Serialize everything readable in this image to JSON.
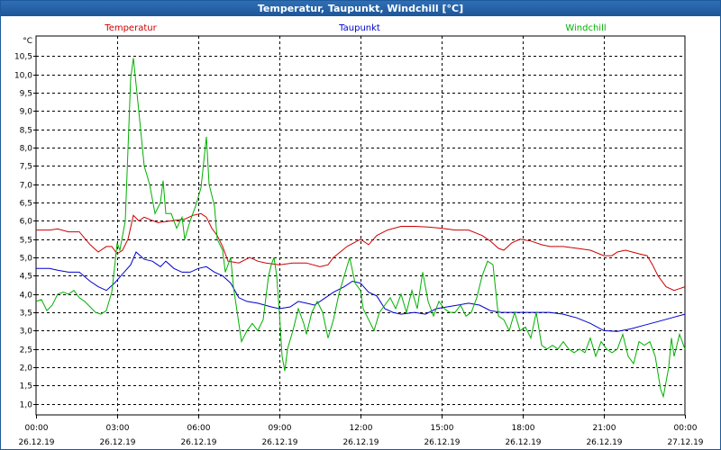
{
  "window": {
    "title": "Temperatur, Taupunkt, Windchill [°C]"
  },
  "chart_data": {
    "type": "line",
    "title": "Temperatur, Taupunkt, Windchill [°C]",
    "ylabel": "°C",
    "xlabel": "",
    "xlim": [
      0,
      24
    ],
    "ylim": [
      0.7,
      11.05
    ],
    "grid": true,
    "legend_placement": "top",
    "y_ticks": [
      "1,0",
      "1,5",
      "2,0",
      "2,5",
      "3,0",
      "3,5",
      "4,0",
      "4,5",
      "5,0",
      "5,5",
      "6,0",
      "6,5",
      "7,0",
      "7,5",
      "8,0",
      "8,5",
      "9,0",
      "9,5",
      "10,0",
      "10,5"
    ],
    "y_tick_values": [
      1.0,
      1.5,
      2.0,
      2.5,
      3.0,
      3.5,
      4.0,
      4.5,
      5.0,
      5.5,
      6.0,
      6.5,
      7.0,
      7.5,
      8.0,
      8.5,
      9.0,
      9.5,
      10.0,
      10.5
    ],
    "x_ticks": [
      {
        "x": 0,
        "time": "00:00",
        "date": "26.12.19"
      },
      {
        "x": 3,
        "time": "03:00",
        "date": "26.12.19"
      },
      {
        "x": 6,
        "time": "06:00",
        "date": "26.12.19"
      },
      {
        "x": 9,
        "time": "09:00",
        "date": "26.12.19"
      },
      {
        "x": 12,
        "time": "12:00",
        "date": "26.12.19"
      },
      {
        "x": 15,
        "time": "15:00",
        "date": "26.12.19"
      },
      {
        "x": 18,
        "time": "18:00",
        "date": "26.12.19"
      },
      {
        "x": 21,
        "time": "21:00",
        "date": "26.12.19"
      },
      {
        "x": 24,
        "time": "00:00",
        "date": "27.12.19"
      }
    ],
    "series": [
      {
        "name": "Temperatur",
        "color": "#cc0000",
        "points": [
          [
            0,
            5.75
          ],
          [
            0.5,
            5.75
          ],
          [
            0.8,
            5.78
          ],
          [
            1.2,
            5.7
          ],
          [
            1.6,
            5.7
          ],
          [
            2.0,
            5.35
          ],
          [
            2.3,
            5.15
          ],
          [
            2.6,
            5.3
          ],
          [
            2.8,
            5.3
          ],
          [
            2.9,
            5.2
          ],
          [
            3.0,
            5.1
          ],
          [
            3.2,
            5.2
          ],
          [
            3.4,
            5.5
          ],
          [
            3.6,
            6.15
          ],
          [
            3.8,
            6.0
          ],
          [
            4.0,
            6.1
          ],
          [
            4.5,
            5.95
          ],
          [
            5.0,
            6.0
          ],
          [
            5.5,
            6.05
          ],
          [
            5.8,
            6.15
          ],
          [
            6.1,
            6.2
          ],
          [
            6.3,
            6.1
          ],
          [
            6.5,
            5.8
          ],
          [
            6.7,
            5.6
          ],
          [
            6.9,
            5.3
          ],
          [
            7.1,
            4.9
          ],
          [
            7.5,
            4.85
          ],
          [
            7.9,
            5.0
          ],
          [
            8.2,
            4.9
          ],
          [
            8.5,
            4.85
          ],
          [
            9.0,
            4.8
          ],
          [
            9.5,
            4.85
          ],
          [
            10.0,
            4.85
          ],
          [
            10.5,
            4.75
          ],
          [
            10.8,
            4.8
          ],
          [
            11.0,
            5.0
          ],
          [
            11.5,
            5.3
          ],
          [
            12.0,
            5.5
          ],
          [
            12.3,
            5.35
          ],
          [
            12.6,
            5.6
          ],
          [
            13.0,
            5.75
          ],
          [
            13.5,
            5.85
          ],
          [
            14.0,
            5.85
          ],
          [
            14.5,
            5.83
          ],
          [
            15.0,
            5.8
          ],
          [
            15.5,
            5.75
          ],
          [
            16.0,
            5.75
          ],
          [
            16.5,
            5.6
          ],
          [
            16.8,
            5.45
          ],
          [
            17.1,
            5.25
          ],
          [
            17.3,
            5.2
          ],
          [
            17.6,
            5.4
          ],
          [
            17.9,
            5.5
          ],
          [
            18.3,
            5.45
          ],
          [
            18.7,
            5.35
          ],
          [
            19.0,
            5.3
          ],
          [
            19.5,
            5.3
          ],
          [
            20.0,
            5.25
          ],
          [
            20.5,
            5.2
          ],
          [
            21.0,
            5.05
          ],
          [
            21.3,
            5.05
          ],
          [
            21.5,
            5.15
          ],
          [
            21.8,
            5.2
          ],
          [
            22.3,
            5.1
          ],
          [
            22.6,
            5.05
          ],
          [
            22.8,
            4.8
          ],
          [
            23.0,
            4.5
          ],
          [
            23.3,
            4.2
          ],
          [
            23.6,
            4.1
          ],
          [
            23.8,
            4.15
          ],
          [
            24.0,
            4.2
          ]
        ]
      },
      {
        "name": "Taupunkt",
        "color": "#0000cc",
        "points": [
          [
            0,
            4.7
          ],
          [
            0.5,
            4.7
          ],
          [
            0.8,
            4.65
          ],
          [
            1.2,
            4.6
          ],
          [
            1.6,
            4.6
          ],
          [
            2.0,
            4.35
          ],
          [
            2.3,
            4.2
          ],
          [
            2.6,
            4.1
          ],
          [
            2.9,
            4.3
          ],
          [
            3.2,
            4.55
          ],
          [
            3.5,
            4.8
          ],
          [
            3.7,
            5.15
          ],
          [
            4.0,
            4.95
          ],
          [
            4.3,
            4.9
          ],
          [
            4.6,
            4.75
          ],
          [
            4.8,
            4.9
          ],
          [
            5.1,
            4.7
          ],
          [
            5.4,
            4.6
          ],
          [
            5.7,
            4.6
          ],
          [
            6.0,
            4.7
          ],
          [
            6.3,
            4.75
          ],
          [
            6.6,
            4.6
          ],
          [
            6.9,
            4.5
          ],
          [
            7.2,
            4.3
          ],
          [
            7.5,
            3.9
          ],
          [
            7.8,
            3.8
          ],
          [
            8.2,
            3.75
          ],
          [
            8.7,
            3.65
          ],
          [
            9.0,
            3.6
          ],
          [
            9.4,
            3.65
          ],
          [
            9.7,
            3.8
          ],
          [
            10.0,
            3.75
          ],
          [
            10.3,
            3.7
          ],
          [
            10.6,
            3.85
          ],
          [
            11.0,
            4.05
          ],
          [
            11.4,
            4.2
          ],
          [
            11.7,
            4.35
          ],
          [
            12.0,
            4.3
          ],
          [
            12.3,
            4.05
          ],
          [
            12.6,
            3.95
          ],
          [
            12.9,
            3.6
          ],
          [
            13.2,
            3.5
          ],
          [
            13.5,
            3.45
          ],
          [
            14.0,
            3.5
          ],
          [
            14.4,
            3.45
          ],
          [
            14.8,
            3.6
          ],
          [
            15.2,
            3.65
          ],
          [
            15.6,
            3.7
          ],
          [
            16.0,
            3.75
          ],
          [
            16.4,
            3.7
          ],
          [
            16.8,
            3.55
          ],
          [
            17.2,
            3.5
          ],
          [
            17.6,
            3.5
          ],
          [
            18.0,
            3.5
          ],
          [
            18.5,
            3.5
          ],
          [
            19.0,
            3.5
          ],
          [
            19.5,
            3.45
          ],
          [
            20.0,
            3.35
          ],
          [
            20.5,
            3.2
          ],
          [
            21.0,
            3.0
          ],
          [
            21.5,
            2.98
          ],
          [
            22.0,
            3.05
          ],
          [
            22.5,
            3.15
          ],
          [
            23.0,
            3.25
          ],
          [
            23.5,
            3.35
          ],
          [
            24.0,
            3.45
          ]
        ]
      },
      {
        "name": "Windchill",
        "color": "#00b000",
        "points": [
          [
            0,
            3.8
          ],
          [
            0.2,
            3.85
          ],
          [
            0.4,
            3.55
          ],
          [
            0.6,
            3.7
          ],
          [
            0.8,
            4.0
          ],
          [
            1.0,
            4.05
          ],
          [
            1.2,
            4.0
          ],
          [
            1.4,
            4.1
          ],
          [
            1.6,
            3.9
          ],
          [
            1.8,
            3.8
          ],
          [
            2.0,
            3.65
          ],
          [
            2.2,
            3.5
          ],
          [
            2.4,
            3.45
          ],
          [
            2.6,
            3.55
          ],
          [
            2.8,
            4.05
          ],
          [
            2.9,
            4.7
          ],
          [
            3.0,
            5.4
          ],
          [
            3.1,
            5.2
          ],
          [
            3.3,
            6.0
          ],
          [
            3.5,
            9.9
          ],
          [
            3.6,
            10.45
          ],
          [
            3.8,
            9.0
          ],
          [
            4.0,
            7.5
          ],
          [
            4.2,
            7.0
          ],
          [
            4.4,
            6.2
          ],
          [
            4.6,
            6.5
          ],
          [
            4.7,
            7.1
          ],
          [
            4.8,
            6.2
          ],
          [
            5.0,
            6.2
          ],
          [
            5.2,
            5.8
          ],
          [
            5.4,
            6.1
          ],
          [
            5.5,
            5.5
          ],
          [
            5.7,
            6.0
          ],
          [
            5.9,
            6.4
          ],
          [
            6.1,
            6.9
          ],
          [
            6.2,
            7.6
          ],
          [
            6.3,
            8.3
          ],
          [
            6.4,
            7.0
          ],
          [
            6.6,
            6.4
          ],
          [
            6.7,
            5.5
          ],
          [
            6.9,
            5.2
          ],
          [
            7.0,
            4.6
          ],
          [
            7.2,
            5.0
          ],
          [
            7.3,
            4.2
          ],
          [
            7.5,
            3.2
          ],
          [
            7.6,
            2.7
          ],
          [
            7.8,
            3.0
          ],
          [
            8.0,
            3.2
          ],
          [
            8.2,
            3.0
          ],
          [
            8.4,
            3.3
          ],
          [
            8.6,
            4.5
          ],
          [
            8.7,
            4.8
          ],
          [
            8.8,
            5.0
          ],
          [
            8.9,
            4.5
          ],
          [
            9.0,
            3.5
          ],
          [
            9.1,
            2.3
          ],
          [
            9.2,
            1.9
          ],
          [
            9.3,
            2.5
          ],
          [
            9.5,
            3.0
          ],
          [
            9.7,
            3.6
          ],
          [
            9.9,
            3.2
          ],
          [
            10.0,
            2.9
          ],
          [
            10.2,
            3.5
          ],
          [
            10.4,
            3.8
          ],
          [
            10.6,
            3.5
          ],
          [
            10.8,
            2.8
          ],
          [
            11.0,
            3.3
          ],
          [
            11.2,
            4.0
          ],
          [
            11.4,
            4.5
          ],
          [
            11.6,
            5.0
          ],
          [
            11.8,
            4.3
          ],
          [
            12.0,
            4.1
          ],
          [
            12.1,
            3.6
          ],
          [
            12.3,
            3.3
          ],
          [
            12.5,
            3.0
          ],
          [
            12.7,
            3.5
          ],
          [
            12.9,
            3.7
          ],
          [
            13.1,
            3.9
          ],
          [
            13.3,
            3.6
          ],
          [
            13.5,
            4.0
          ],
          [
            13.7,
            3.5
          ],
          [
            13.9,
            4.1
          ],
          [
            14.1,
            3.6
          ],
          [
            14.3,
            4.6
          ],
          [
            14.5,
            3.8
          ],
          [
            14.7,
            3.4
          ],
          [
            14.9,
            3.8
          ],
          [
            15.1,
            3.6
          ],
          [
            15.3,
            3.5
          ],
          [
            15.5,
            3.5
          ],
          [
            15.7,
            3.7
          ],
          [
            15.9,
            3.4
          ],
          [
            16.1,
            3.5
          ],
          [
            16.3,
            3.9
          ],
          [
            16.5,
            4.5
          ],
          [
            16.7,
            4.9
          ],
          [
            16.9,
            4.8
          ],
          [
            17.1,
            3.4
          ],
          [
            17.3,
            3.3
          ],
          [
            17.5,
            3.0
          ],
          [
            17.7,
            3.5
          ],
          [
            17.9,
            3.0
          ],
          [
            18.1,
            3.1
          ],
          [
            18.3,
            2.8
          ],
          [
            18.5,
            3.5
          ],
          [
            18.7,
            2.6
          ],
          [
            18.9,
            2.5
          ],
          [
            19.1,
            2.6
          ],
          [
            19.3,
            2.5
          ],
          [
            19.5,
            2.7
          ],
          [
            19.7,
            2.5
          ],
          [
            19.9,
            2.4
          ],
          [
            20.1,
            2.5
          ],
          [
            20.3,
            2.4
          ],
          [
            20.5,
            2.8
          ],
          [
            20.7,
            2.3
          ],
          [
            20.9,
            2.7
          ],
          [
            21.1,
            2.5
          ],
          [
            21.3,
            2.4
          ],
          [
            21.5,
            2.5
          ],
          [
            21.7,
            2.9
          ],
          [
            21.9,
            2.3
          ],
          [
            22.1,
            2.1
          ],
          [
            22.3,
            2.7
          ],
          [
            22.5,
            2.6
          ],
          [
            22.7,
            2.7
          ],
          [
            22.9,
            2.3
          ],
          [
            23.1,
            1.4
          ],
          [
            23.2,
            1.2
          ],
          [
            23.4,
            2.0
          ],
          [
            23.5,
            2.8
          ],
          [
            23.6,
            2.3
          ],
          [
            23.8,
            2.9
          ],
          [
            24.0,
            2.5
          ]
        ]
      }
    ]
  }
}
